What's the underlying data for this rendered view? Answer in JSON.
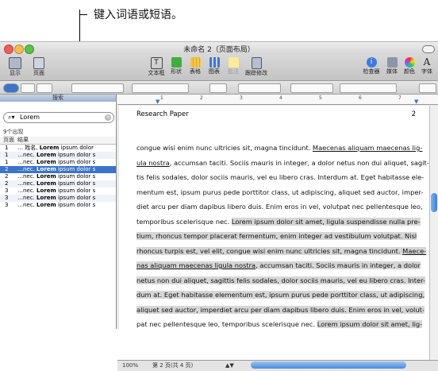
{
  "callout": {
    "text": "键入词语或短语。"
  },
  "window": {
    "title": "未命名 2（页面布局）"
  },
  "toolbar": {
    "left": [
      {
        "label": "显示",
        "icon": "display-icon"
      },
      {
        "label": "页面",
        "icon": "pages-icon"
      }
    ],
    "center": [
      {
        "label": "文本框",
        "icon": "textbox-icon"
      },
      {
        "label": "形状",
        "icon": "shapes-icon"
      },
      {
        "label": "表格",
        "icon": "table-icon"
      },
      {
        "label": "图表",
        "icon": "chart-icon"
      },
      {
        "label": "批注",
        "icon": "comment-icon"
      },
      {
        "label": "跟踪修改",
        "icon": "track-changes-icon"
      }
    ],
    "right": [
      {
        "label": "检查器",
        "icon": "inspector-icon"
      },
      {
        "label": "媒体",
        "icon": "media-icon"
      },
      {
        "label": "颜色",
        "icon": "colors-icon"
      },
      {
        "label": "字体",
        "icon": "fonts-icon"
      }
    ]
  },
  "sidebar": {
    "header": "搜索",
    "search_value": "Lorem",
    "result_count": "9个出现",
    "col_page": "页面",
    "col_result": "结果",
    "rows": [
      {
        "page": "1",
        "pre": "… 姓名, ",
        "match": "Lorem",
        "post": " ipsum dolor"
      },
      {
        "page": "1",
        "pre": "…nec. ",
        "match": "Lorem",
        "post": " ipsum dolor s"
      },
      {
        "page": "1",
        "pre": "…nec. ",
        "match": "Lorem",
        "post": " ipsum dolor s"
      },
      {
        "page": "2",
        "pre": "…nec. ",
        "match": "Lorem",
        "post": " ipsum dolor s"
      },
      {
        "page": "2",
        "pre": "…nec. ",
        "match": "Lorem",
        "post": " ipsum dolor s"
      },
      {
        "page": "2",
        "pre": "…nec. ",
        "match": "Lorem",
        "post": " ipsum dolor s"
      },
      {
        "page": "3",
        "pre": "…nec. ",
        "match": "Lorem",
        "post": " ipsum dolor s"
      },
      {
        "page": "3",
        "pre": "…nec. ",
        "match": "Lorem",
        "post": " ipsum dolor s"
      },
      {
        "page": "3",
        "pre": "…nec. ",
        "match": "Lorem",
        "post": " ipsum dolor s"
      }
    ],
    "selected_index": 3
  },
  "ruler": {
    "ticks": [
      "1",
      "2",
      "3",
      "4",
      "5",
      "6",
      "7"
    ]
  },
  "document": {
    "header_left": "Research Paper",
    "page_number": "2",
    "lines": [
      [
        {
          "t": "congue wisi enim nunc ultricies sit, magna tincidunt. "
        },
        {
          "t": "Maecenas aliquam maecenas lig-",
          "u": true
        }
      ],
      [
        {
          "t": "ula nostra",
          "u": true
        },
        {
          "t": ", accumsan taciti. Sociis mauris in integer, a dolor netus non dui aliquet, sagit-"
        }
      ],
      [
        {
          "t": "tis felis sodales, dolor sociis mauris, vel eu libero cras. Interdum at. Eget habitasse ele-"
        }
      ],
      [
        {
          "t": "mentum est, ipsum purus pede porttitor class, ut adipiscing, aliquet sed auctor, imper-"
        }
      ],
      [
        {
          "t": "diet arcu per diam dapibus libero duis. Enim eros in vel, volutpat nec pellentesque leo,"
        }
      ],
      [
        {
          "t": "temporibus scelerisque nec. "
        },
        {
          "t": "Lorem ipsum dolor sit amet, ligula suspendisse nulla pre-",
          "h": true
        }
      ],
      [
        {
          "t": "tium, rhoncus tempor placerat fermentum, enim integer ad vestibulum volutpat. Nisl",
          "h": true
        }
      ],
      [
        {
          "t": "rhoncus turpis est, vel elit, congue wisi enim nunc ultricies sit, magna tincidunt. ",
          "h": true
        },
        {
          "t": "Maece-",
          "h": true,
          "u": true
        }
      ],
      [
        {
          "t": "nas aliquam maecenas ligula nostra",
          "h": true,
          "u": true
        },
        {
          "t": ", accumsan taciti. Sociis mauris in integer, a dolor",
          "h": true
        }
      ],
      [
        {
          "t": "netus non dui aliquet, sagittis felis sodales, dolor sociis mauris, vel eu libero cras. Inter-",
          "h": true
        }
      ],
      [
        {
          "t": "dum at. Eget habitasse elementum est, ipsum purus pede porttitor class, ut adipiscing,",
          "h": true
        }
      ],
      [
        {
          "t": "aliquet sed auctor, imperdiet arcu per diam dapibus libero duis. Enim eros in vel, volut-",
          "h": true
        }
      ],
      [
        {
          "t": "pat nec pellentesque leo, temporibus scelerisque nec. "
        },
        {
          "t": "Lorem ipsum dolor sit amet, lig-",
          "h": true
        }
      ]
    ]
  },
  "status": {
    "zoom": "100%",
    "page_info": "第 2 页(共 4 页)"
  },
  "colors": {
    "selection": "#3d74c9",
    "highlight": "#d6d6d6",
    "sidebar_header": "#b3c3da"
  }
}
